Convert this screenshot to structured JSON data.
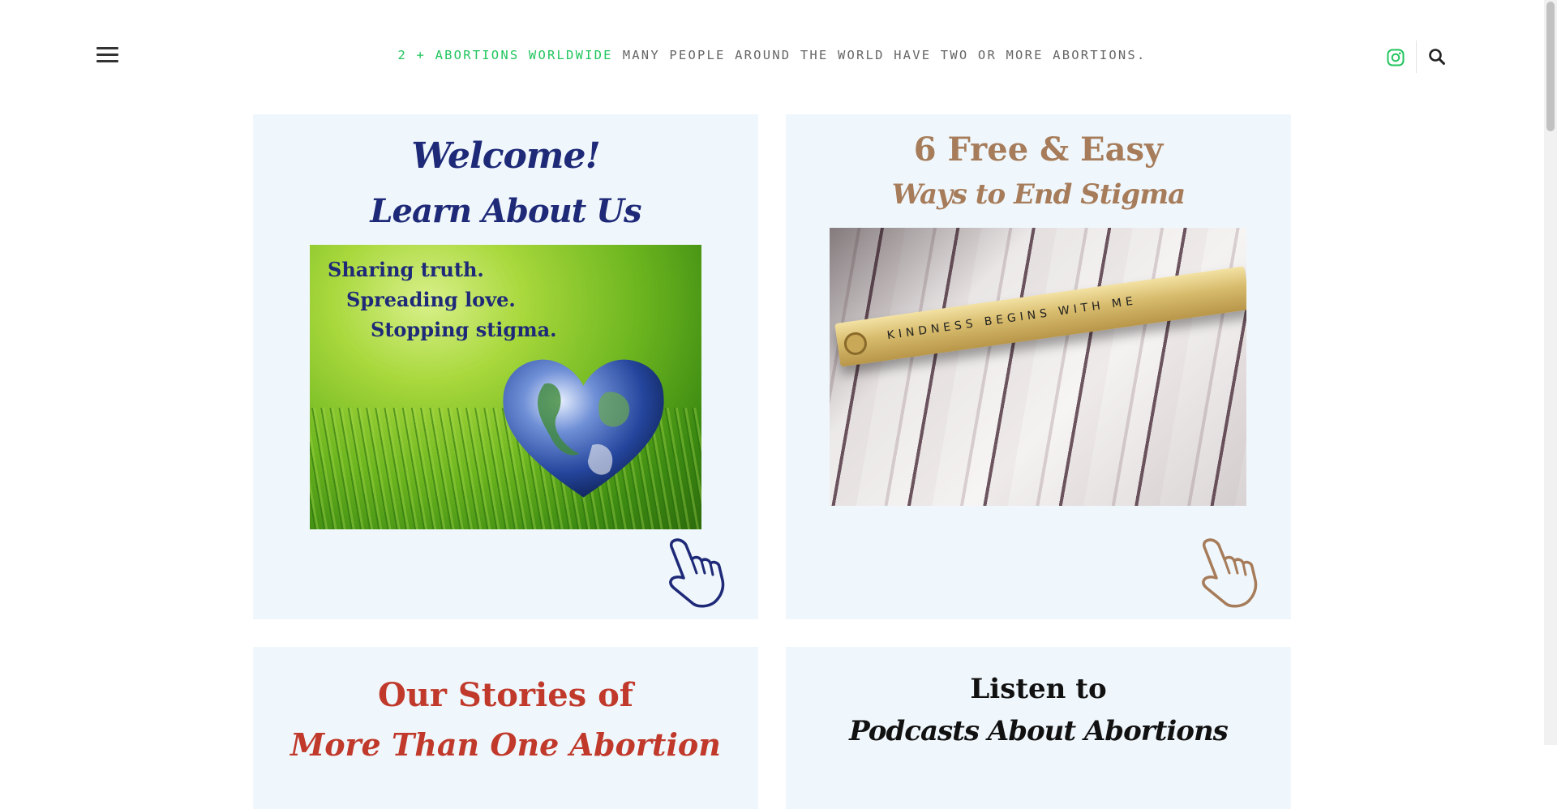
{
  "header": {
    "brand": "2 + ABORTIONS WORLDWIDE",
    "tagline": "MANY PEOPLE AROUND THE WORLD HAVE TWO OR MORE ABORTIONS.",
    "menu_icon": "hamburger-menu-icon",
    "social_icon": "instagram-icon",
    "search_icon": "search-icon",
    "brand_color": "#22c55e"
  },
  "cards": {
    "welcome": {
      "title": "Welcome!",
      "subtitle": "Learn About Us",
      "image_lines": [
        "Sharing truth.",
        "Spreading love.",
        "Stopping stigma."
      ],
      "pointer_icon": "hand-pointer-icon",
      "accent": "#1e2a78"
    },
    "ways": {
      "title": "6 Free & Easy",
      "subtitle": "Ways to End Stigma",
      "image_text": "KINDNESS BEGINS WITH ME",
      "pointer_icon": "hand-pointer-icon",
      "accent": "#a67c5a"
    },
    "stories": {
      "title": "Our  Stories of",
      "subtitle": "More Than One Abortion",
      "accent": "#c0392b"
    },
    "podcasts": {
      "title": "Listen to",
      "subtitle": "Podcasts About Abortions",
      "accent": "#111111"
    }
  }
}
